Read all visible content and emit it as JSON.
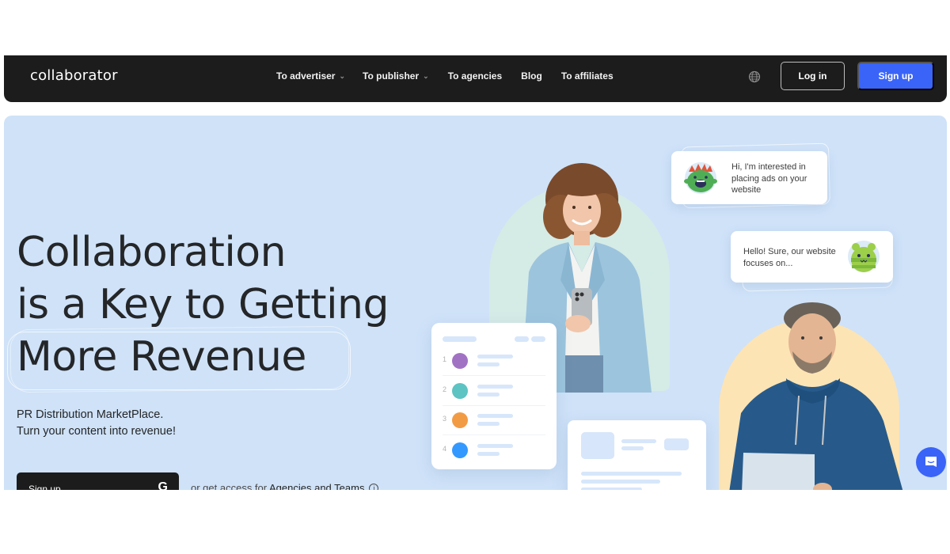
{
  "navbar": {
    "logo": "collaborator",
    "links": [
      {
        "label": "To advertiser",
        "has_dropdown": true
      },
      {
        "label": "To publisher",
        "has_dropdown": true
      },
      {
        "label": "To agencies",
        "has_dropdown": false
      },
      {
        "label": "Blog",
        "has_dropdown": false
      },
      {
        "label": "To affiliates",
        "has_dropdown": false
      }
    ],
    "chevron_glyph": "⌄",
    "language_icon": "globe-icon",
    "login_label": "Log in",
    "signup_label": "Sign up"
  },
  "hero": {
    "headline": [
      "Collaboration",
      "is a Key to Getting",
      "More Revenue"
    ],
    "subtitle": [
      "PR Distribution MarketPlace.",
      "Turn your content into revenue!"
    ],
    "cta": {
      "label": "Sign up",
      "google_glyph": "G",
      "alt_prefix": "or get access for ",
      "alt_link": "Agencies and Teams",
      "info_glyph": "i"
    },
    "chat": [
      {
        "text": "Hi, I'm interested in placing ads on your website",
        "avatar": "green-monster-avatar"
      },
      {
        "text": "Hello! Sure, our website focuses on...",
        "avatar": "green-blob-avatar"
      }
    ],
    "ranking_card": {
      "rows": [
        {
          "rank": "1",
          "color": "#a172c4"
        },
        {
          "rank": "2",
          "color": "#5dc3c3"
        },
        {
          "rank": "3",
          "color": "#f29b45"
        },
        {
          "rank": "4",
          "color": "#3399ff"
        }
      ]
    }
  },
  "colors": {
    "navbar_bg": "#1c1c1c",
    "accent_blue": "#3a64f8",
    "hero_bg": "#cfe2f8",
    "text_dark": "#242628"
  }
}
